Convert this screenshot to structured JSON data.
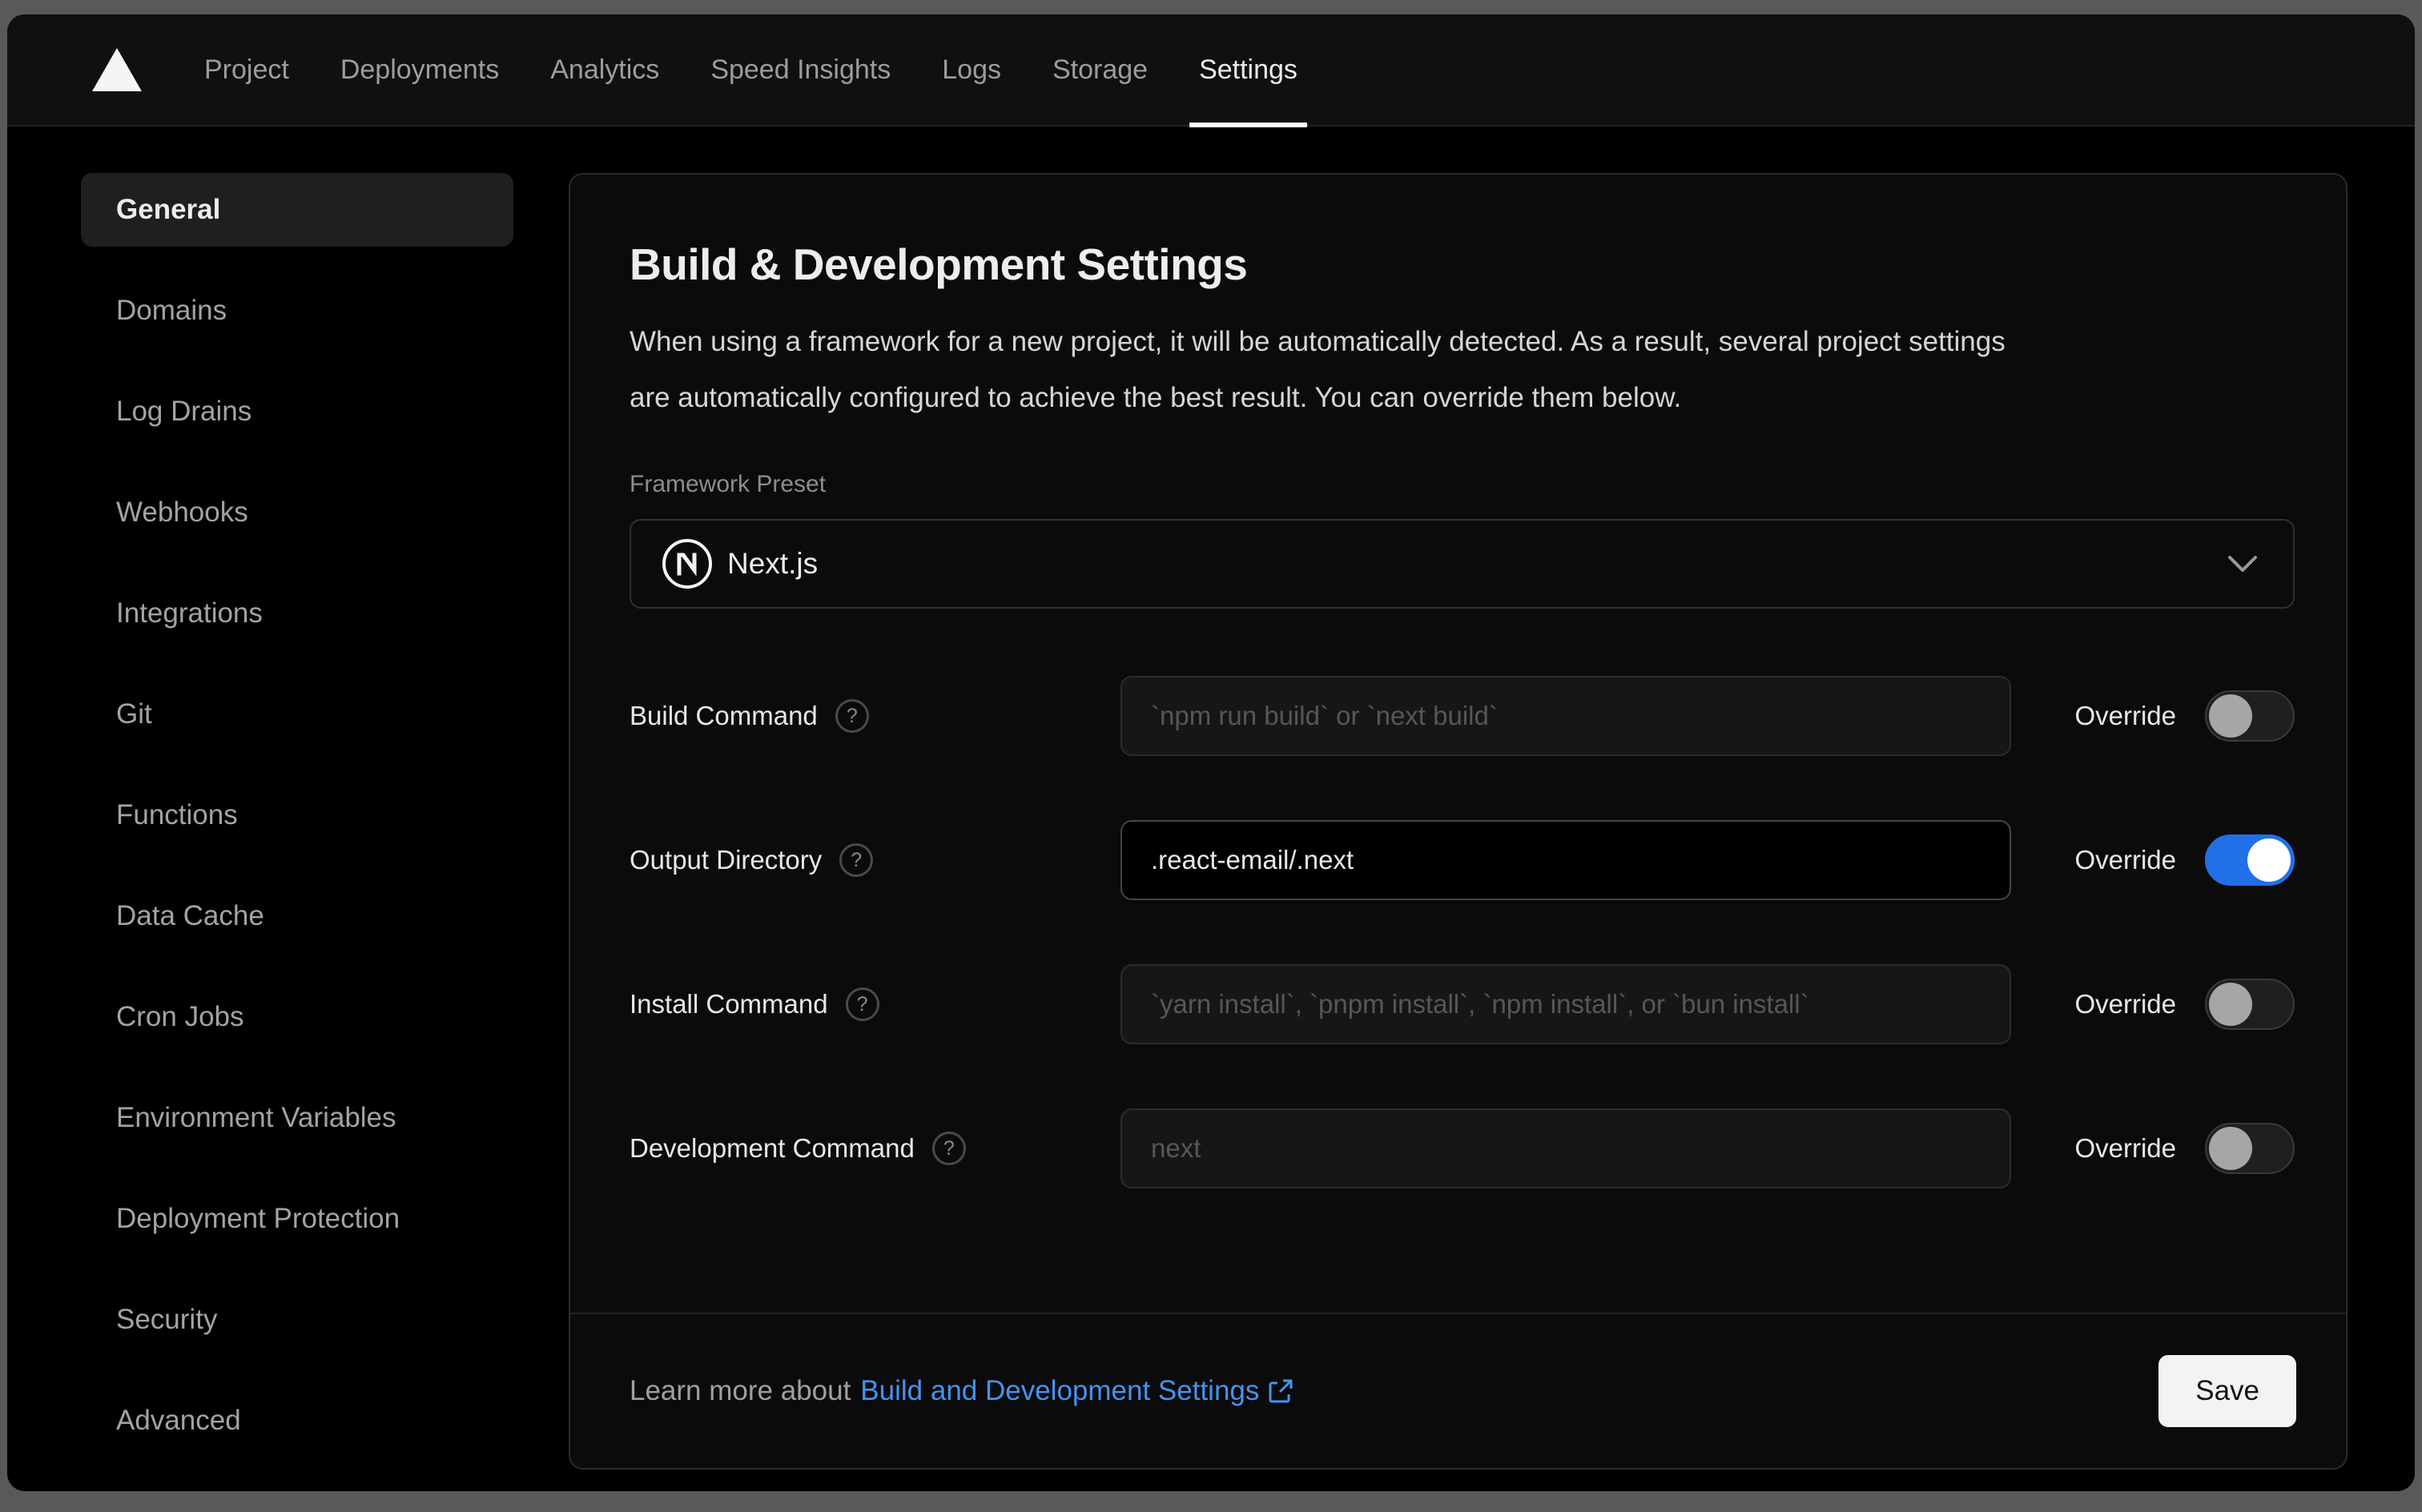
{
  "nav": {
    "logo": "vercel-triangle",
    "tabs": [
      {
        "label": "Project",
        "active": false
      },
      {
        "label": "Deployments",
        "active": false
      },
      {
        "label": "Analytics",
        "active": false
      },
      {
        "label": "Speed Insights",
        "active": false
      },
      {
        "label": "Logs",
        "active": false
      },
      {
        "label": "Storage",
        "active": false
      },
      {
        "label": "Settings",
        "active": true
      }
    ]
  },
  "sidebar": {
    "items": [
      {
        "label": "General",
        "active": true
      },
      {
        "label": "Domains",
        "active": false
      },
      {
        "label": "Log Drains",
        "active": false
      },
      {
        "label": "Webhooks",
        "active": false
      },
      {
        "label": "Integrations",
        "active": false
      },
      {
        "label": "Git",
        "active": false
      },
      {
        "label": "Functions",
        "active": false
      },
      {
        "label": "Data Cache",
        "active": false
      },
      {
        "label": "Cron Jobs",
        "active": false
      },
      {
        "label": "Environment Variables",
        "active": false
      },
      {
        "label": "Deployment Protection",
        "active": false
      },
      {
        "label": "Security",
        "active": false
      },
      {
        "label": "Advanced",
        "active": false
      }
    ]
  },
  "panel": {
    "title": "Build & Development Settings",
    "description": "When using a framework for a new project, it will be automatically detected. As a result, several project settings are automatically configured to achieve the best result. You can override them below.",
    "framework": {
      "label": "Framework Preset",
      "value": "Next.js",
      "icon": "nextjs-logo",
      "chevron": "chevron-down"
    },
    "override_label": "Override",
    "fields": [
      {
        "label": "Build Command",
        "placeholder": "`npm run build` or `next build`",
        "value": "",
        "override": false
      },
      {
        "label": "Output Directory",
        "placeholder": "",
        "value": ".react-email/.next",
        "override": true
      },
      {
        "label": "Install Command",
        "placeholder": "`yarn install`, `pnpm install`, `npm install`, or `bun install`",
        "value": "",
        "override": false
      },
      {
        "label": "Development Command",
        "placeholder": "next",
        "value": "",
        "override": false
      }
    ],
    "footer": {
      "prefix": "Learn more about",
      "link": "Build and Development Settings",
      "link_icon": "external-link",
      "save_label": "Save"
    }
  },
  "colors": {
    "page_frame": "#595959",
    "window_bg": "#000000",
    "nav_bg": "#101010",
    "card_bg": "#0b0b0b",
    "card_border": "#2a2a2a",
    "active_item_bg": "#1f1f1f",
    "text_primary": "#ededed",
    "text_secondary": "#a3a3a3",
    "placeholder": "#575757",
    "toggle_on": "#2170e8",
    "link_blue": "#4693f0",
    "save_bg": "#f3f3f3"
  }
}
